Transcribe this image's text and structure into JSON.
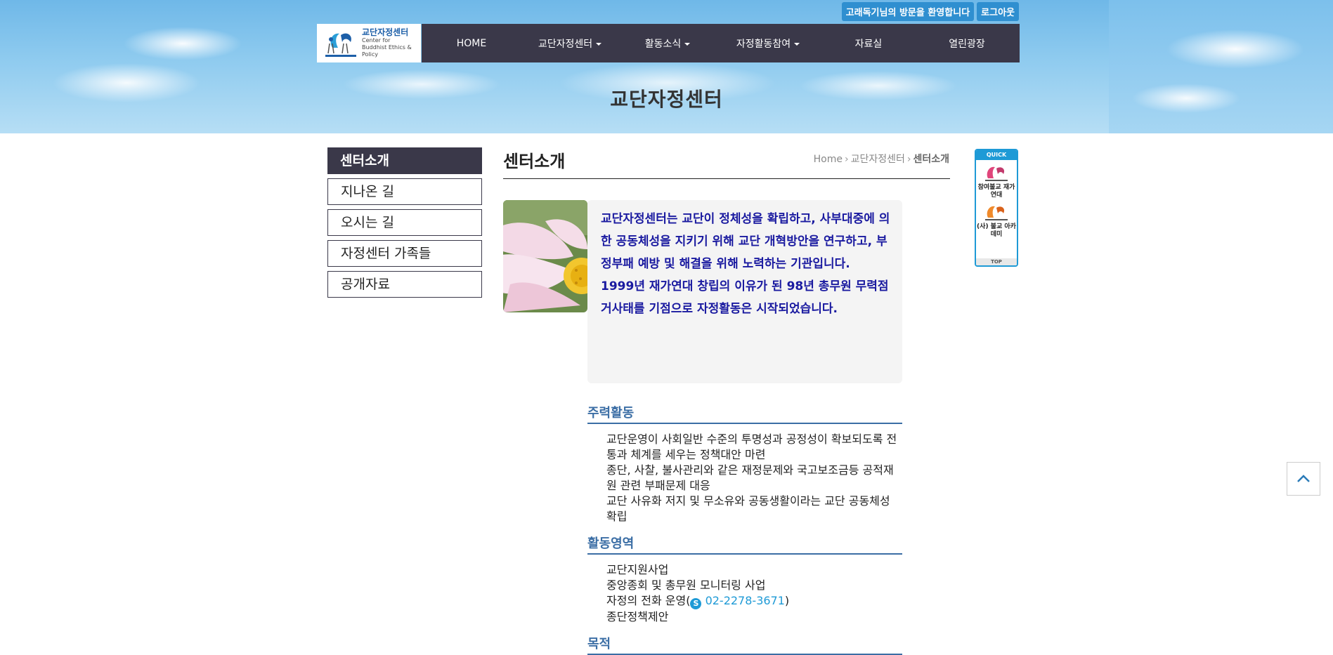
{
  "banner": {
    "title": "교단자정센터"
  },
  "utility": {
    "welcome": "고래독기님의 방문을 환영합니다",
    "logout": "로그아웃"
  },
  "logo": {
    "name_ko": "교단자정센터",
    "name_en_1": "Center for",
    "name_en_2": "Buddhist Ethics & Policy"
  },
  "gnb": {
    "items": [
      {
        "label": "HOME",
        "dropdown": false
      },
      {
        "label": "교단자정센터",
        "dropdown": true
      },
      {
        "label": "활동소식",
        "dropdown": true
      },
      {
        "label": "자정활동참여",
        "dropdown": true
      },
      {
        "label": "자료실",
        "dropdown": false
      },
      {
        "label": "열린광장",
        "dropdown": false
      }
    ]
  },
  "lnb": {
    "head": "센터소개",
    "items": [
      "지나온 길",
      "오시는 길",
      "자정센터 가족들",
      "공개자료"
    ]
  },
  "page": {
    "title": "센터소개",
    "breadcrumb": [
      "Home",
      "교단자정센터",
      "센터소개"
    ]
  },
  "intro": {
    "text_1": "교단자정센터는 교단이 정체성을 확립하고, 사부대중에 의한 공동체성을 지키기 위해 교단 개혁방안을 연구하고, 부정부패 예방 및 해결을 위해 노력하는 기관입니다.",
    "text_2": "1999년 재가연대 창립의 이유가 된 98년 총무원 무력점거사태를 기점으로 자정활동은 시작되었습니다."
  },
  "sections": {
    "main_activities": {
      "heading": "주력활동",
      "items": [
        "교단운영이 사회일반 수준의 투명성과 공정성이 확보되도록 전통과 체계를 세우는 정책대안 마련",
        "종단, 사찰, 불사관리와 같은 재정문제와 국고보조금등 공적재원 관련 부패문제 대응",
        "교단 사유화 저지 및 무소유와 공동생활이라는 교단 공동체성 확립"
      ]
    },
    "areas": {
      "heading": "활동영역",
      "items": [
        "교단지원사업",
        "중앙종회 및 총무원 모니터링 사업",
        "자정의 전화 운영(",
        "종단정책제안"
      ],
      "phone": "02-2278-3671",
      "phone_close": ")"
    },
    "purpose": {
      "heading": "목적"
    }
  },
  "quick": {
    "head": "QUICK",
    "item_1": "참여불교 재가연대",
    "item_2": "(사) 불교 아카데미",
    "top": "TOP"
  },
  "colors": {
    "nav": "#3a3849",
    "accent": "#1e9ad6",
    "intro_text": "#1a1aa0",
    "section_head": "#3b6ea5"
  }
}
